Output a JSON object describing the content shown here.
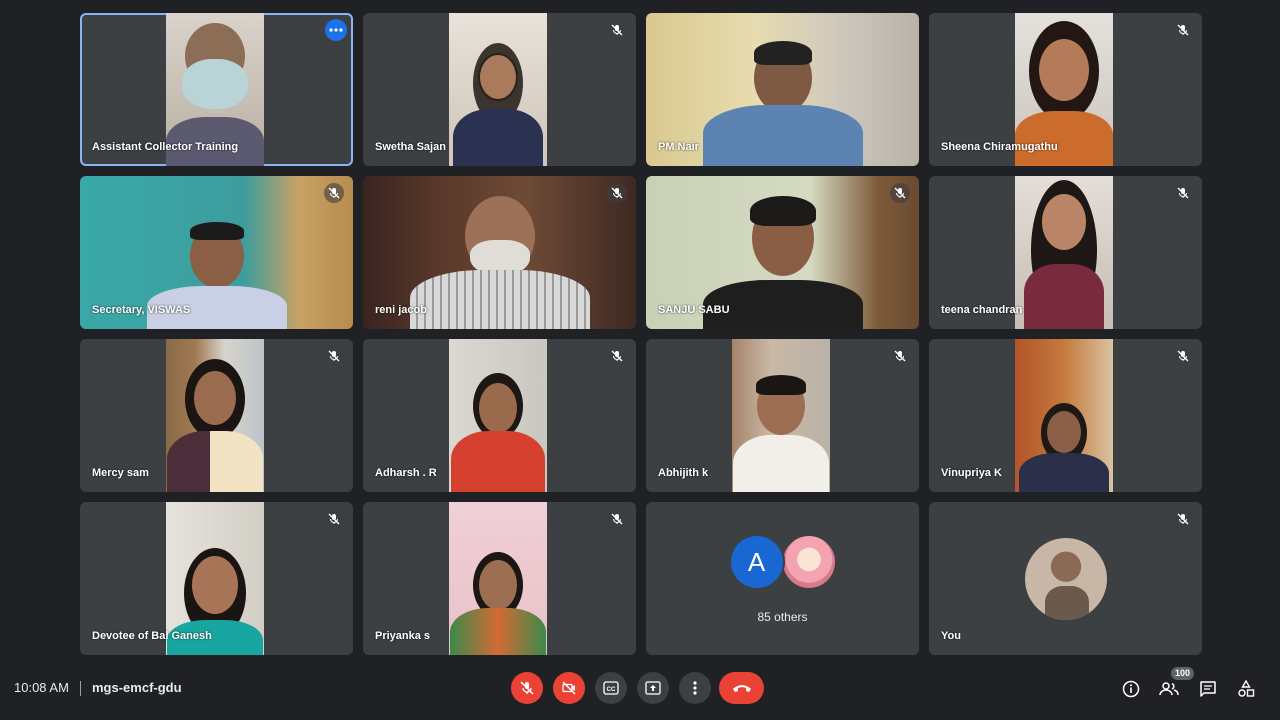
{
  "participants": [
    {
      "name": "Assistant Collector Training"
    },
    {
      "name": "Swetha Sajan"
    },
    {
      "name": "PM Nair"
    },
    {
      "name": "Sheena Chiramugathu"
    },
    {
      "name": "Secretary, VISWAS"
    },
    {
      "name": "reni jacob"
    },
    {
      "name": "SANJU SABU"
    },
    {
      "name": "teena chandran"
    },
    {
      "name": "Mercy sam"
    },
    {
      "name": "Adharsh . R"
    },
    {
      "name": "Abhijith k"
    },
    {
      "name": "Vinupriya K"
    },
    {
      "name": "Devotee of Bal Ganesh"
    },
    {
      "name": "Priyanka s"
    }
  ],
  "others": {
    "avatar_letter": "A",
    "label": "85 others"
  },
  "self": {
    "label": "You"
  },
  "bottom_bar": {
    "time": "10:08 AM",
    "meeting_code": "mgs-emcf-gdu",
    "participant_count": "100"
  },
  "icons": {
    "mic_off": "mic-off-icon",
    "camera_off": "camera-off-icon",
    "captions": "captions-icon",
    "present": "present-screen-icon",
    "more": "more-options-icon",
    "end_call": "end-call-icon",
    "info": "info-icon",
    "people": "people-icon",
    "chat": "chat-icon",
    "activities": "activities-icon"
  },
  "colors": {
    "background": "#202124",
    "tile": "#3c4043",
    "accent_blue": "#1a73e8",
    "active_border": "#8ab4f8",
    "danger_red": "#ea4335"
  }
}
